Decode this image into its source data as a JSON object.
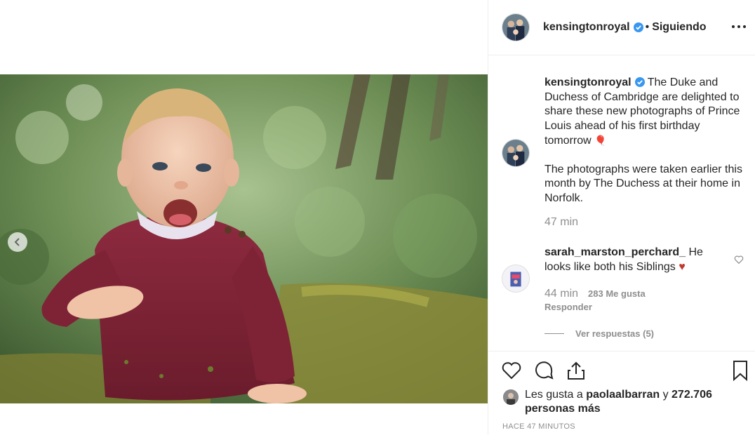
{
  "post": {
    "username": "kensingtonroyal",
    "follow_separator": "•",
    "follow_status": "Siguiendo",
    "more_icon": "more-horizontal-icon"
  },
  "caption": {
    "username": "kensingtonroyal",
    "line1": "The Duke and Duchess of Cambridge are delighted to share these new photographs of Prince Louis ahead of his first birthday tomorrow",
    "balloon_emoji": "🎈",
    "line2": "The photographs were taken earlier this month by The Duchess at their home in Norfolk.",
    "time": "47 min"
  },
  "comment": {
    "username": "sarah_marston_perchard_",
    "text": "He looks like both his Siblings",
    "heart_emoji": "♥",
    "time": "44 min",
    "likes": "283 Me gusta",
    "reply_label": "Responder",
    "view_replies": "Ver respuestas (5)"
  },
  "likes": {
    "prefix": "Les gusta a",
    "user": "paolaalbarran",
    "conj": "y",
    "others": "272.706 personas más"
  },
  "timestamp": "HACE 47 MINUTOS",
  "colors": {
    "verified": "#3897f0",
    "secondary_text": "#8e8e8e",
    "primary_text": "#262626",
    "separator": "#efefef"
  }
}
